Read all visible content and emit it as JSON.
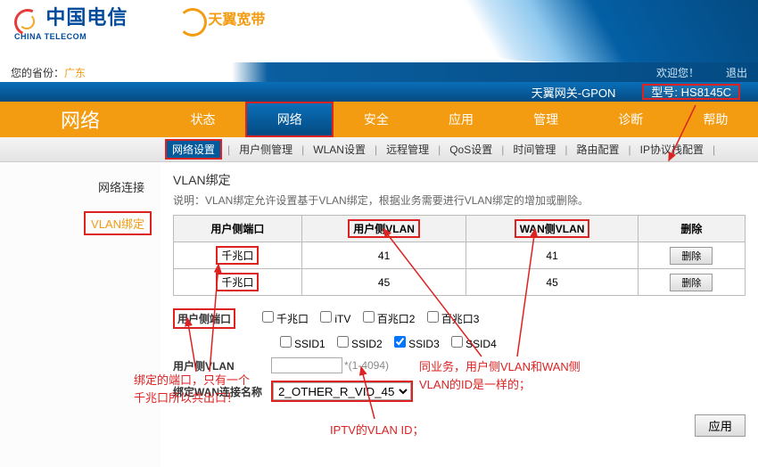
{
  "header": {
    "logo1_cn": "中国电信",
    "logo1_en": "CHINA TELECOM",
    "logo2": "天翼宽带",
    "province_label": "您的省份：",
    "province_value": "广东",
    "welcome": "欢迎您！",
    "logout": "退出",
    "gateway": "天翼网关-GPON",
    "model_label": "型号: HS8145C"
  },
  "nav": {
    "title": "网络",
    "tabs": [
      "状态",
      "网络",
      "安全",
      "应用",
      "管理",
      "诊断",
      "帮助"
    ],
    "active": 1
  },
  "subnav": {
    "items": [
      "网络设置",
      "用户侧管理",
      "WLAN设置",
      "远程管理",
      "QoS设置",
      "时间管理",
      "路由配置",
      "IP协议栈配置"
    ],
    "active": 0
  },
  "sidebar": {
    "items": [
      "网络连接",
      "VLAN绑定"
    ],
    "active": 1
  },
  "section": {
    "title": "VLAN绑定",
    "desc": "说明：VLAN绑定允许设置基于VLAN绑定，根据业务需要进行VLAN绑定的增加或删除。"
  },
  "table": {
    "headers": [
      "用户侧端口",
      "用户侧VLAN",
      "WAN侧VLAN",
      "删除"
    ],
    "rows": [
      {
        "port": "千兆口",
        "uvlan": "41",
        "wvlan": "41"
      },
      {
        "port": "千兆口",
        "uvlan": "45",
        "wvlan": "45"
      }
    ],
    "del_label": "删除"
  },
  "form": {
    "port_label": "用户侧端口",
    "checkboxes_r1": [
      "千兆口",
      "iTV",
      "百兆口2",
      "百兆口3"
    ],
    "checkboxes_r2": [
      "SSID1",
      "SSID2",
      "SSID3",
      "SSID4"
    ],
    "uvlan_label": "用户侧VLAN",
    "uvlan_value": "",
    "uvlan_hint": "*(1-4094)",
    "wan_label": "绑定WAN连接名称",
    "wan_value": "2_OTHER_R_VID_45",
    "apply_label": "应用"
  },
  "annotations": {
    "a1": "绑定的端口，只有一个\n千兆口所以共出口！",
    "a2": "IPTV的VLAN ID；",
    "a3": "同业务，用户侧VLAN和WAN侧\nVLAN的ID是一样的；"
  }
}
